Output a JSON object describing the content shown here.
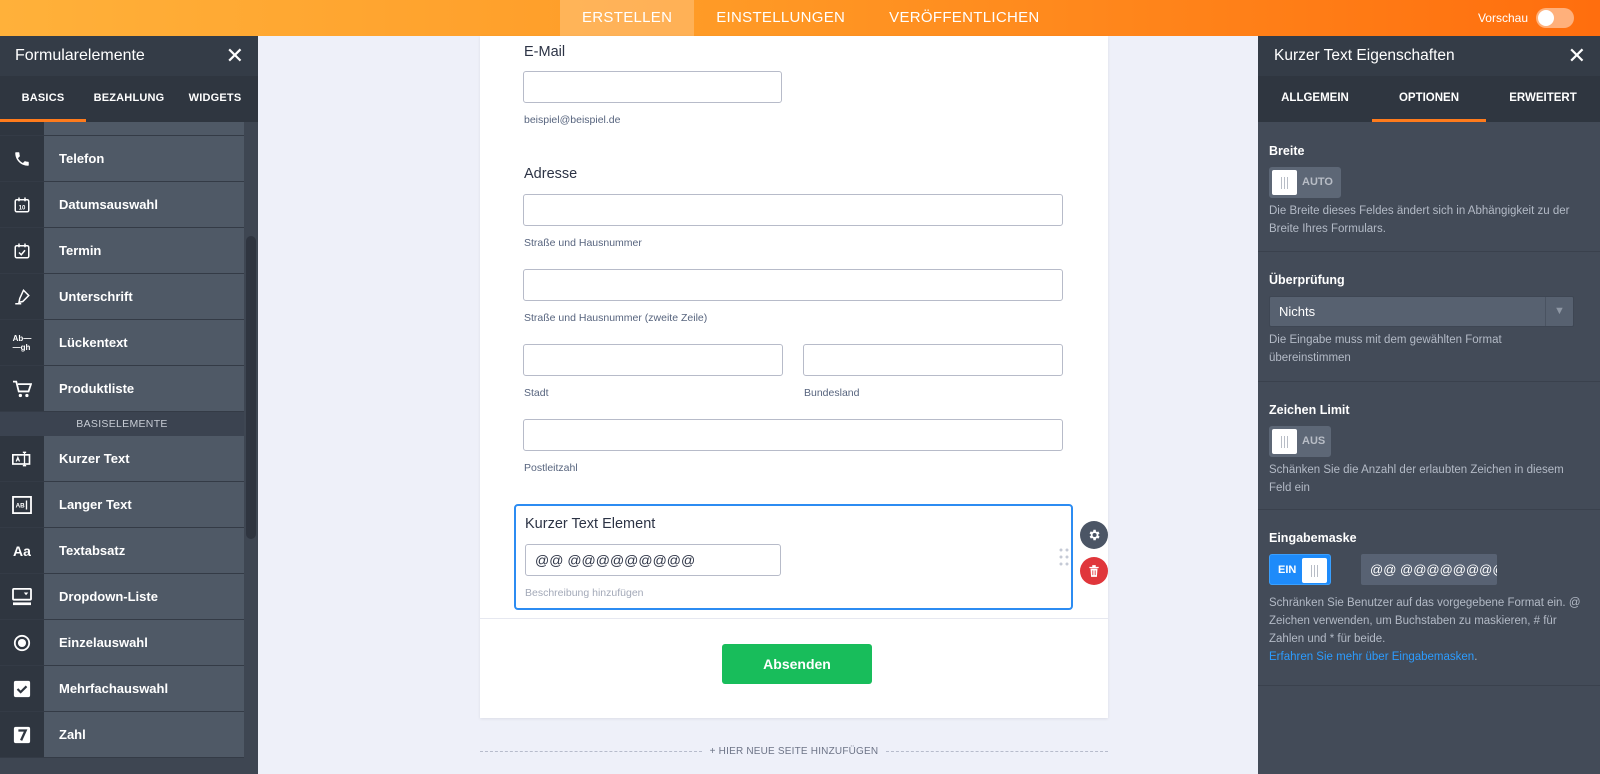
{
  "topbar": {
    "tabs": [
      "ERSTELLEN",
      "EINSTELLUNGEN",
      "VERÖFFENTLICHEN"
    ],
    "preview_label": "Vorschau"
  },
  "left_panel": {
    "title": "Formularelemente",
    "tabs": [
      "BASICS",
      "BEZAHLUNG",
      "WIDGETS"
    ],
    "items_top": [
      {
        "label": "Telefon",
        "icon": "phone-icon"
      },
      {
        "label": "Datumsauswahl",
        "icon": "calendar-icon"
      },
      {
        "label": "Termin",
        "icon": "appointment-icon"
      },
      {
        "label": "Unterschrift",
        "icon": "signature-icon"
      },
      {
        "label": "Lückentext",
        "icon": "fill-blank-icon"
      },
      {
        "label": "Produktliste",
        "icon": "cart-icon"
      }
    ],
    "section_label": "BASISELEMENTE",
    "items_bottom": [
      {
        "label": "Kurzer Text",
        "icon": "short-text-icon"
      },
      {
        "label": "Langer Text",
        "icon": "long-text-icon"
      },
      {
        "label": "Textabsatz",
        "icon": "paragraph-icon"
      },
      {
        "label": "Dropdown-Liste",
        "icon": "dropdown-icon"
      },
      {
        "label": "Einzelauswahl",
        "icon": "radio-icon"
      },
      {
        "label": "Mehrfachauswahl",
        "icon": "checkbox-icon"
      },
      {
        "label": "Zahl",
        "icon": "number-icon"
      }
    ]
  },
  "form": {
    "email_label": "E-Mail",
    "email_sub": "beispiel@beispiel.de",
    "address_label": "Adresse",
    "street_sub": "Straße und Hausnummer",
    "street2_sub": "Straße und Hausnummer (zweite Zeile)",
    "city_sub": "Stadt",
    "state_sub": "Bundesland",
    "zip_sub": "Postleitzahl",
    "short_text_label": "Kurzer Text Element",
    "short_text_value": "@@ @@@@@@@@@",
    "short_text_desc": "Beschreibung hinzufügen",
    "submit_label": "Absenden",
    "add_page_label": "+ HIER NEUE SEITE HINZUFÜGEN"
  },
  "right_panel": {
    "title": "Kurzer Text Eigenschaften",
    "tabs": [
      "ALLGEMEIN",
      "OPTIONEN",
      "ERWEITERT"
    ],
    "width": {
      "title": "Breite",
      "toggle": "AUTO",
      "desc": "Die Breite dieses Feldes ändert sich in Abhängigkeit zu der Breite Ihres Formulars."
    },
    "validation": {
      "title": "Überprüfung",
      "value": "Nichts",
      "desc": "Die Eingabe muss mit dem gewählten Format übereinstimmen"
    },
    "char_limit": {
      "title": "Zeichen Limit",
      "toggle": "AUS",
      "desc": "Schänken Sie die Anzahl der erlaubten Zeichen in diesem Feld ein"
    },
    "input_mask": {
      "title": "Eingabemaske",
      "toggle": "EIN",
      "value": "@@ @@@@@@@@@",
      "desc": "Schränken Sie Benutzer auf das vorgegebene Format ein. @ Zeichen verwenden, um Buchstaben zu maskieren, # für Zahlen und * für beide.",
      "link": "Erfahren Sie mehr über Eingabemasken"
    }
  },
  "colors": {
    "accent_orange": "#ff7b1c",
    "submit_green": "#18bd5b",
    "select_blue": "#2c8cf2",
    "delete_red": "#e0363b"
  }
}
